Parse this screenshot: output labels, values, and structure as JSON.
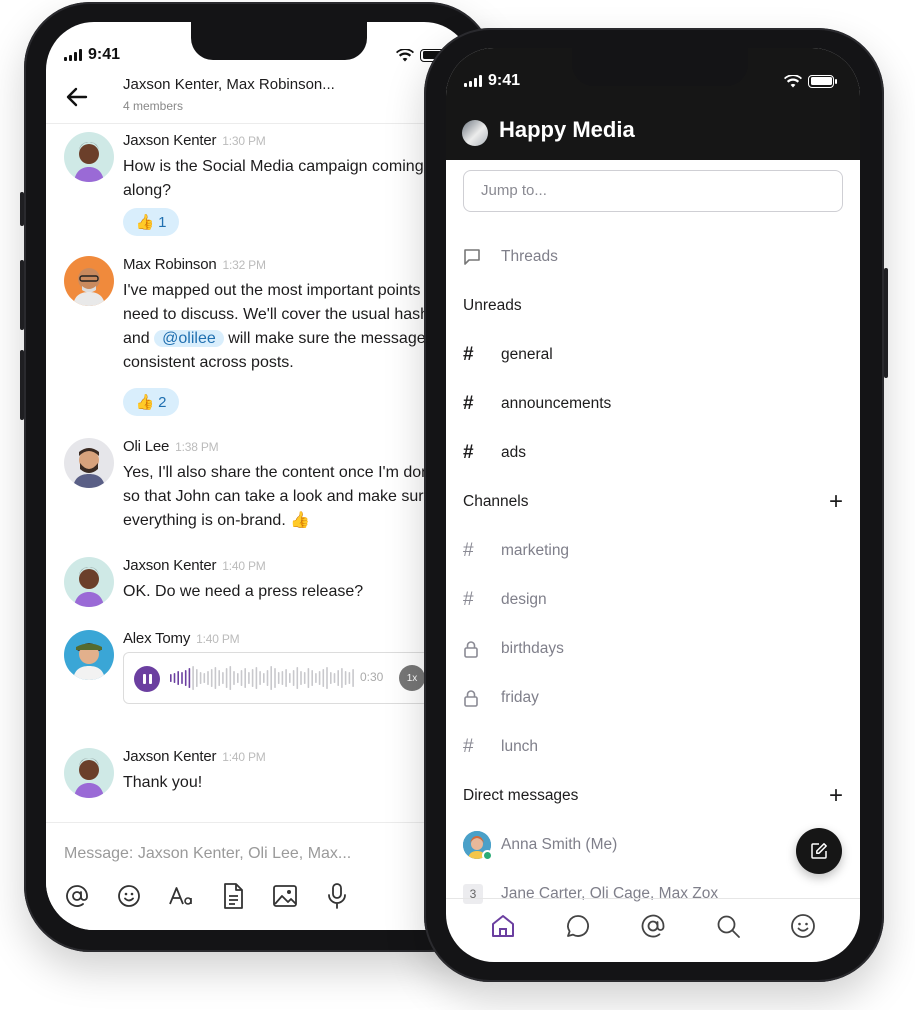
{
  "left_phone": {
    "status": {
      "time": "9:41"
    },
    "header": {
      "title": "Jaxson Kenter, Max Robinson...",
      "subtitle": "4 members"
    },
    "messages": [
      {
        "author": "Jaxson Kenter",
        "time": "1:30 PM",
        "text": "How is the Social Media campaign coming along?",
        "reaction": {
          "emoji": "👍",
          "count": "1"
        }
      },
      {
        "author": "Max Robinson",
        "time": "1:32 PM",
        "text_parts": [
          "I've mapped out the most important points we need to discuss. We'll cover the usual hashtags and ",
          "@olilee",
          " will make sure the message is consistent across posts."
        ],
        "reaction": {
          "emoji": "👍",
          "count": "2"
        }
      },
      {
        "author": "Oli Lee",
        "time": "1:38 PM",
        "text": "Yes, I'll also share the content once I'm done, so that John can take a look and make sure everything is on-brand. 👍"
      },
      {
        "author": "Jaxson Kenter",
        "time": "1:40 PM",
        "text": "OK. Do we need a press release?"
      },
      {
        "author": "Alex Tomy",
        "time": "1:40 PM",
        "voice": {
          "duration": "0:30",
          "speed": "1x",
          "progress": 0.12
        }
      },
      {
        "author": "Jaxson Kenter",
        "time": "1:40 PM",
        "text": "Thank you!"
      }
    ],
    "composer": {
      "placeholder": "Message: Jaxson Kenter, Oli Lee, Max..."
    },
    "toolbar_icons": [
      "at-icon",
      "emoji-icon",
      "text-format-icon",
      "document-icon",
      "image-icon",
      "microphone-icon"
    ]
  },
  "right_phone": {
    "status": {
      "time": "9:41"
    },
    "workspace": "Happy Media",
    "jump_placeholder": "Jump to...",
    "threads_label": "Threads",
    "unreads": {
      "label": "Unreads",
      "channels": [
        "general",
        "announcements",
        "ads"
      ]
    },
    "channels": {
      "label": "Channels",
      "items": [
        {
          "name": "marketing",
          "icon": "hash-icon"
        },
        {
          "name": "design",
          "icon": "hash-icon"
        },
        {
          "name": "birthdays",
          "icon": "lock-icon"
        },
        {
          "name": "friday",
          "icon": "lock-icon"
        },
        {
          "name": "lunch",
          "icon": "hash-icon"
        }
      ]
    },
    "direct_messages": {
      "label": "Direct messages",
      "items": [
        {
          "name": "Anna Smith (Me)",
          "status": "online"
        },
        {
          "name": "Jane Carter, Oli Cage, Max Zox",
          "count": "3"
        }
      ]
    },
    "tab_icons": [
      "home-icon",
      "chat-icon",
      "mentions-icon",
      "search-icon",
      "profile-icon"
    ],
    "colors": {
      "accent": "#6b3fa0",
      "header_bg": "#161616",
      "mention_bg": "#d9eefc",
      "online": "#2bac76"
    }
  }
}
